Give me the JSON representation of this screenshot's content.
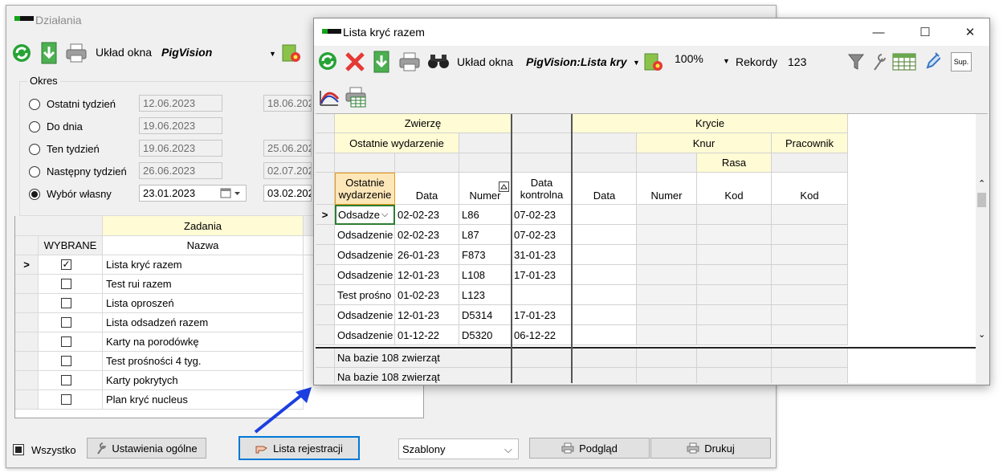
{
  "back_window": {
    "title": "Działania",
    "toolbar": {
      "layout_label": "Układ okna",
      "layout_value": "PigVision",
      "icons": [
        "refresh-icon",
        "download-icon",
        "printer-icon",
        "settings-gear-icon"
      ]
    },
    "okres": {
      "legend": "Okres",
      "options": [
        {
          "label": "Ostatni tydzień",
          "from": "12.06.2023",
          "to": "18.06.202",
          "selected": false
        },
        {
          "label": "Do dnia",
          "from": "19.06.2023",
          "to": "",
          "selected": false
        },
        {
          "label": "Ten tydzień",
          "from": "19.06.2023",
          "to": "25.06.202",
          "selected": false
        },
        {
          "label": "Następny tydzień",
          "from": "26.06.2023",
          "to": "02.07.202",
          "selected": false
        },
        {
          "label": "Wybór własny",
          "from": "23.01.2023",
          "to": "03.02.202",
          "selected": true
        }
      ]
    },
    "tasks": {
      "group_header": "Zadania",
      "col_selected": "WYBRANE",
      "col_name": "Nazwa",
      "rows": [
        {
          "name": "Lista kryć razem",
          "checked": true
        },
        {
          "name": "Test rui razem",
          "checked": false
        },
        {
          "name": "Lista oproszeń",
          "checked": false
        },
        {
          "name": "Lista odsadzeń razem",
          "checked": false
        },
        {
          "name": "Karty na porodówkę",
          "checked": false
        },
        {
          "name": "Test prośności 4 tyg.",
          "checked": false
        },
        {
          "name": "Karty pokrytych",
          "checked": false
        },
        {
          "name": "Plan kryć nucleus",
          "checked": false
        }
      ]
    },
    "bottom": {
      "all_label": "Wszystko",
      "settings_button": "Ustawienia ogólne",
      "register_button": "Lista rejestracji",
      "templates_value": "Szablony",
      "preview_button": "Podgląd",
      "print_button": "Drukuj"
    }
  },
  "dialog": {
    "title": "Lista kryć razem",
    "toolbar": {
      "layout_label": "Układ okna",
      "layout_value": "PigVision:Lista kry",
      "zoom": "100%",
      "records_label": "Rekordy",
      "records_value": "123",
      "sup_label": "Sup.",
      "icons": [
        "refresh-icon",
        "close-red-icon",
        "download-icon",
        "printer-icon",
        "binoculars-icon",
        "settings-gear-icon",
        "filter-funnel-icon",
        "wrench-icon",
        "calendar-grid-icon",
        "syringe-icon",
        "curve-chart-icon",
        "print-table-icon"
      ]
    },
    "grid": {
      "headers": {
        "zwierze": "Zwierzę",
        "ostatnie_wydarzenie": "Ostatnie wydarzenie",
        "krycie": "Krycie",
        "knur": "Knur",
        "pracownik": "Pracownik",
        "rasa": "Rasa",
        "col_event": "Ostatnie wydarzenie",
        "col_date": "Data",
        "col_number": "Numer",
        "col_control": "Data kontrolna",
        "col_k_date": "Data",
        "col_k_number": "Numer",
        "col_k_code": "Kod",
        "col_p_code": "Kod"
      },
      "rows": [
        {
          "event": "Odsadzenie",
          "date": "02-02-23",
          "number": "L86",
          "control": "07-02-23"
        },
        {
          "event": "Odsadzenie",
          "date": "02-02-23",
          "number": "L87",
          "control": "07-02-23"
        },
        {
          "event": "Odsadzenie",
          "date": "26-01-23",
          "number": "F873",
          "control": "31-01-23"
        },
        {
          "event": "Odsadzenie",
          "date": "12-01-23",
          "number": "L108",
          "control": "17-01-23"
        },
        {
          "event": "Test prośno",
          "date": "01-02-23",
          "number": "L123",
          "control": ""
        },
        {
          "event": "Odsadzenie",
          "date": "12-01-23",
          "number": "D5314",
          "control": "17-01-23"
        },
        {
          "event": "Odsadzenie",
          "date": "01-12-22",
          "number": "D5320",
          "control": "06-12-22"
        }
      ],
      "footer": [
        "Na bazie 108 zwierząt",
        "Na bazie 108 zwierząt"
      ]
    }
  }
}
